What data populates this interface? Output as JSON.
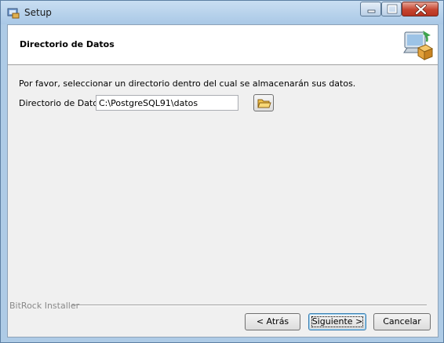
{
  "window": {
    "title": "Setup"
  },
  "header": {
    "title": "Directorio de Datos"
  },
  "content": {
    "description": "Por favor, seleccionar un directorio dentro del cual se almacenarán sus datos.",
    "directory_label": "Directorio de Datos",
    "directory_value": "C:\\PostgreSQL91\\datos"
  },
  "footer": {
    "brand": "BitRock Installer",
    "back_label": "< Atrás",
    "next_label": "Siguiente >",
    "cancel_label": "Cancelar"
  },
  "icons": {
    "app": "setup-icon",
    "header": "computer-install-icon",
    "browse": "folder-open-icon"
  },
  "colors": {
    "title_bar": "#a9c8e6",
    "close_button": "#c6442f",
    "dialog_background": "#f0f0f0"
  }
}
